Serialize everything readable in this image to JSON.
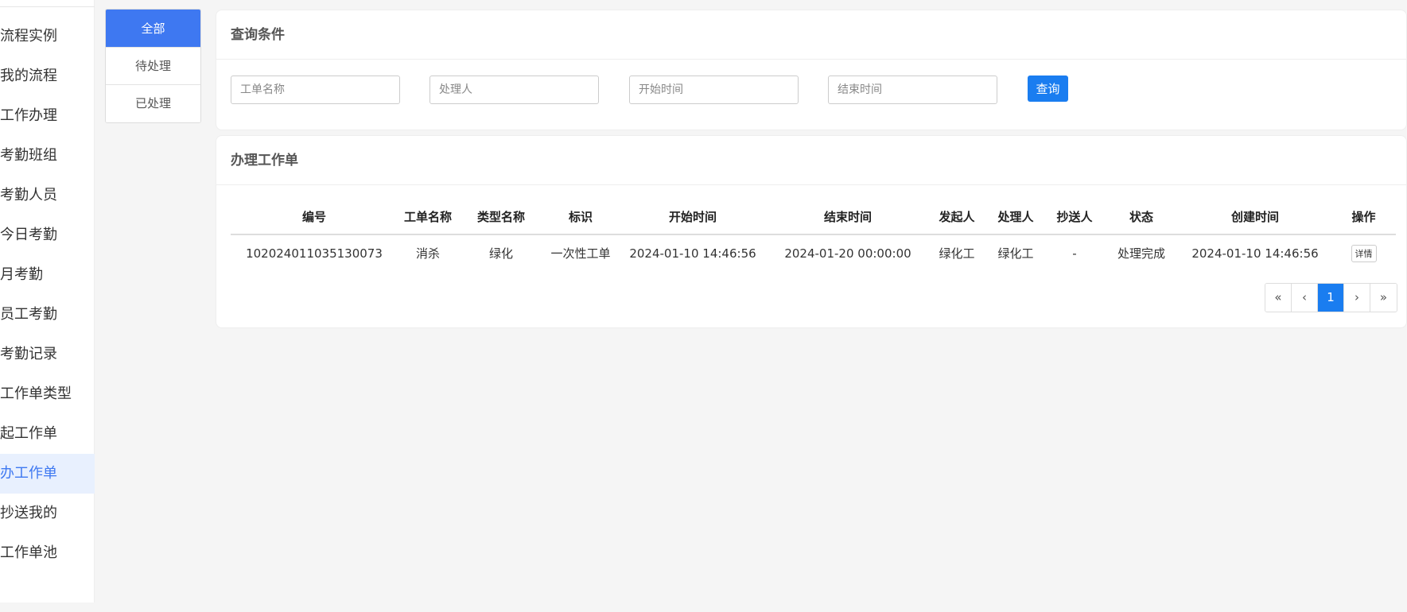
{
  "sidebar": {
    "items": [
      {
        "label": "流程实例",
        "active": false
      },
      {
        "label": "我的流程",
        "active": false
      },
      {
        "label": "工作办理",
        "active": false
      },
      {
        "label": "考勤班组",
        "active": false
      },
      {
        "label": "考勤人员",
        "active": false
      },
      {
        "label": "今日考勤",
        "active": false
      },
      {
        "label": "月考勤",
        "active": false
      },
      {
        "label": "员工考勤",
        "active": false
      },
      {
        "label": "考勤记录",
        "active": false
      },
      {
        "label": "工作单类型",
        "active": false
      },
      {
        "label": "起工作单",
        "active": false
      },
      {
        "label": "办工作单",
        "active": true
      },
      {
        "label": "抄送我的",
        "active": false
      },
      {
        "label": "工作单池",
        "active": false
      }
    ]
  },
  "filter": {
    "all": "全部",
    "pending": "待处理",
    "done": "已处理"
  },
  "query": {
    "title": "查询条件",
    "name_placeholder": "工单名称",
    "handler_placeholder": "处理人",
    "start_placeholder": "开始时间",
    "end_placeholder": "结束时间",
    "search_label": "查询"
  },
  "list": {
    "title": "办理工作单",
    "columns": [
      "编号",
      "工单名称",
      "类型名称",
      "标识",
      "开始时间",
      "结束时间",
      "发起人",
      "处理人",
      "抄送人",
      "状态",
      "创建时间",
      "操作"
    ],
    "rows": [
      [
        "102024011035130073",
        "消杀",
        "绿化",
        "一次性工单",
        "2024-01-10 14:46:56",
        "2024-01-20 00:00:00",
        "绿化工",
        "绿化工",
        "-",
        "处理完成",
        "2024-01-10 14:46:56"
      ]
    ],
    "detail_label": "详情"
  },
  "pager": {
    "first": "«",
    "prev": "‹",
    "current": "1",
    "next": "›",
    "last": "»"
  },
  "colors": {
    "accent": "#3e78f1",
    "primary_button": "#1a7df0"
  }
}
